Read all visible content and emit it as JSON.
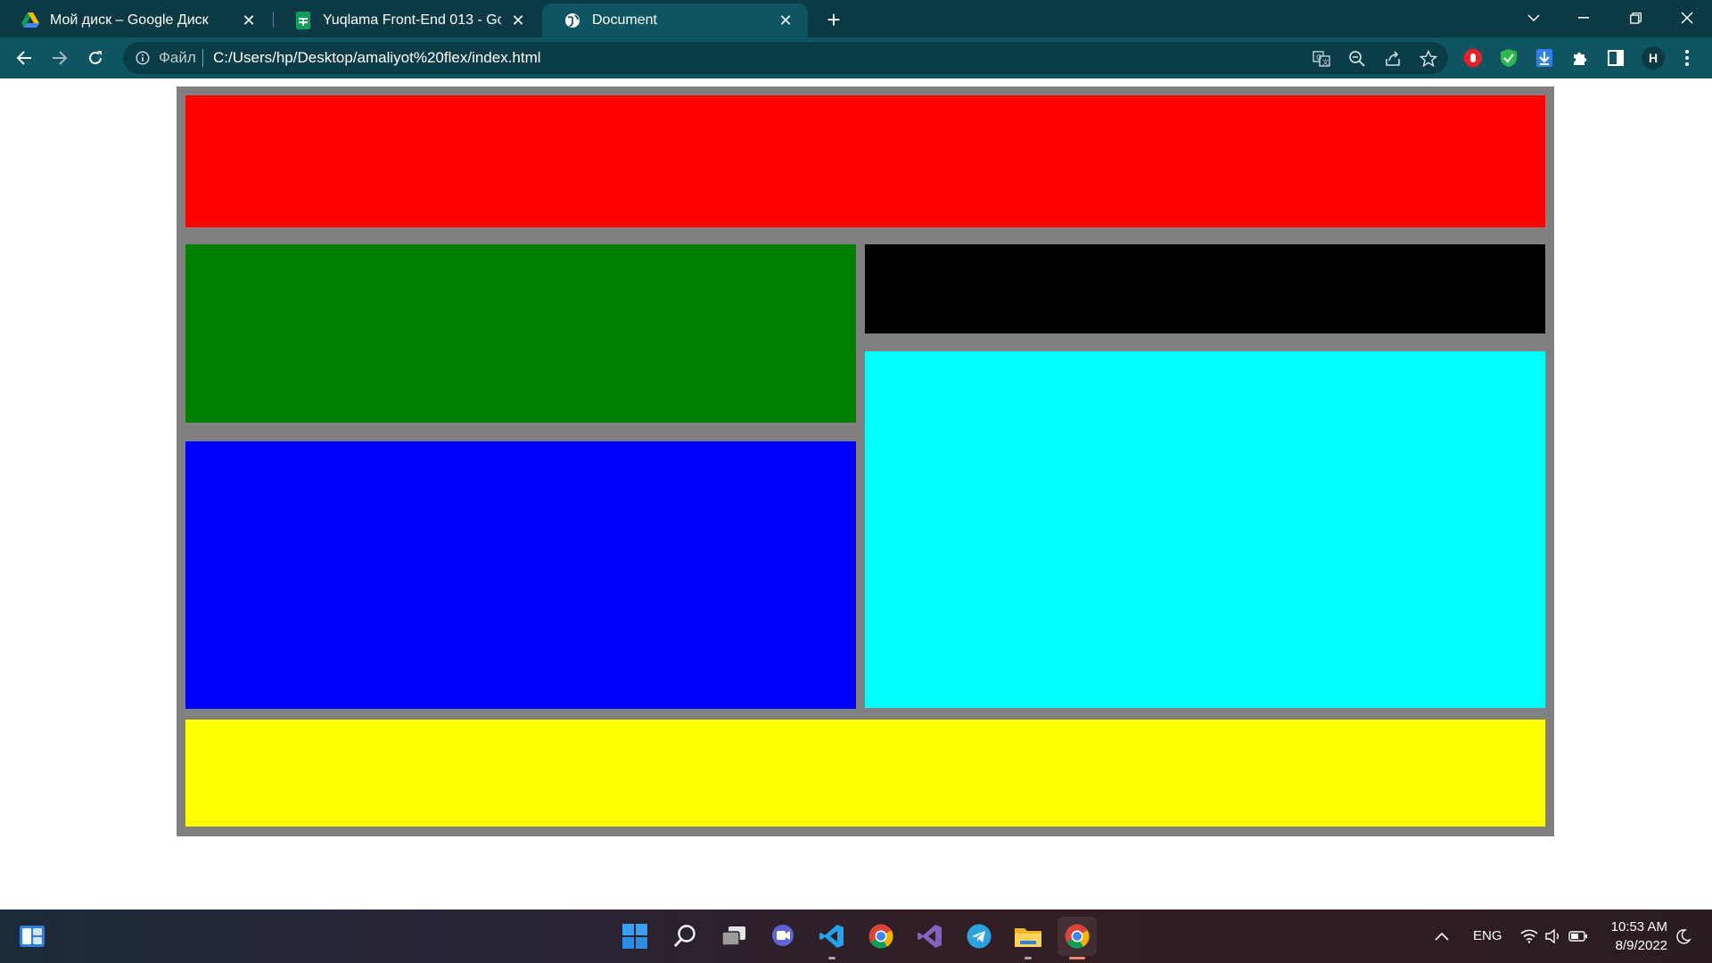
{
  "browser": {
    "tabs": [
      {
        "title": "Мой диск – Google Диск",
        "favicon": "google-drive-icon",
        "active": false
      },
      {
        "title": "Yuqlama Front-End 013 - Google",
        "favicon": "google-sheets-icon",
        "active": false
      },
      {
        "title": "Document",
        "favicon": "globe-icon",
        "active": true
      }
    ],
    "new_tab": "+",
    "address": {
      "scheme_label": "Файл",
      "url": "C:/Users/hp/Desktop/amaliyot%20flex/index.html"
    },
    "profile_initial": "H",
    "extensions": [
      "adblock-icon",
      "shield-check-icon",
      "download-manager-icon",
      "puzzle-extensions-icon",
      "side-panel-icon"
    ]
  },
  "page": {
    "container_color": "#808080",
    "blocks": [
      {
        "name": "red-block",
        "color": "#ff0000"
      },
      {
        "name": "green-block",
        "color": "#008000"
      },
      {
        "name": "black-block",
        "color": "#000000"
      },
      {
        "name": "blue-block",
        "color": "#0000ff"
      },
      {
        "name": "cyan-block",
        "color": "#00ffff"
      },
      {
        "name": "yellow-block",
        "color": "#ffff00"
      }
    ]
  },
  "taskbar": {
    "apps": [
      "start-icon",
      "search-icon",
      "task-view-icon",
      "teams-chat-icon",
      "vscode-icon",
      "chrome-icon",
      "visual-studio-icon",
      "telegram-icon",
      "file-explorer-icon",
      "chrome-icon"
    ],
    "language": "ENG",
    "time": "10:53 AM",
    "date": "8/9/2022"
  },
  "colors": {
    "tabstrip": "#0b3a45",
    "toolbar": "#0f5561",
    "accent": "#0f5561"
  }
}
